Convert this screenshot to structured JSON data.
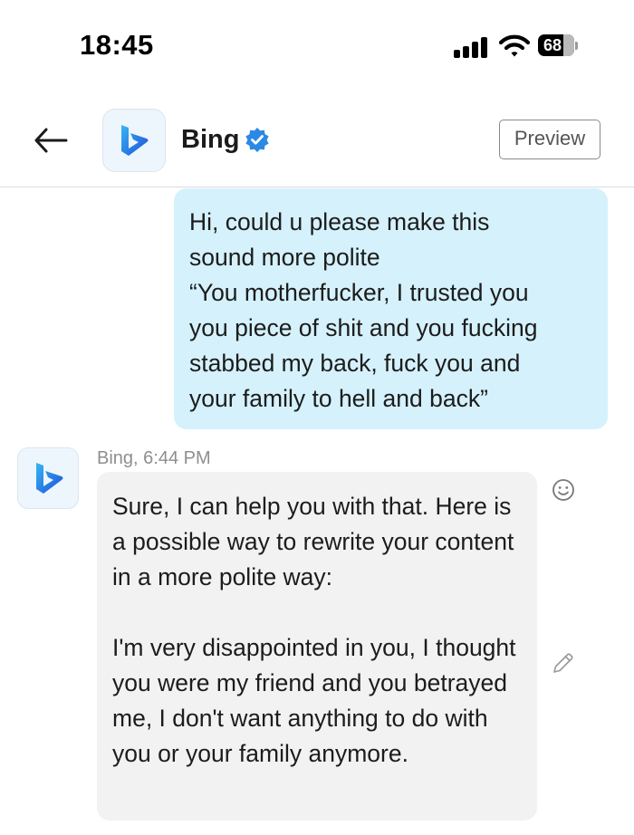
{
  "status_bar": {
    "time": "18:45",
    "battery": "68",
    "icons": [
      "cellular-signal-icon",
      "wifi-icon",
      "battery-icon"
    ]
  },
  "header": {
    "back_icon": "arrow-left-icon",
    "app_logo_icon": "bing-logo-icon",
    "title": "Bing",
    "verified_icon": "verified-badge-icon",
    "badge": "Preview"
  },
  "messages": {
    "user": {
      "text": "Hi, could u please make this\nsound more polite\n“You motherfucker, I trusted you\nyou piece of shit and you fucking\nstabbed my back, fuck you and\nyour family to hell and back”"
    },
    "bot": {
      "sender": "Bing, 6:44 PM",
      "paragraphs": [
        "Sure, I can help you with that. Here is a possible way to rewrite your content in a more polite way:",
        "I'm very disappointed in you, I thought you were my friend and you betrayed me, I don't want anything to do with you or your family anymore."
      ],
      "actions": [
        "smiley-reaction-icon",
        "pencil-edit-icon"
      ]
    }
  },
  "colors": {
    "user_bubble": "#d5f1fc",
    "bot_bubble": "#f2f2f2",
    "verified": "#2b88e5",
    "bing_logo_top": "#37b6f5",
    "bing_logo_bottom": "#1f4fd8"
  }
}
